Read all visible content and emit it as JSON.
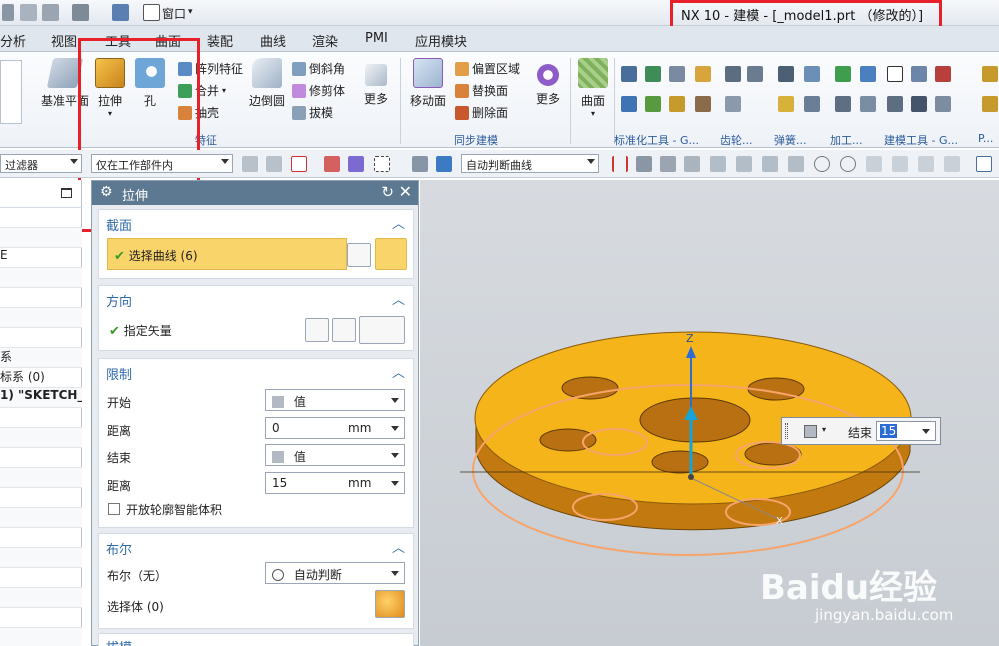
{
  "window": {
    "title": "NX 10 - 建模 - [_model1.prt （修改的）]",
    "window_menu": "窗口"
  },
  "menu": {
    "tabs": [
      "分析",
      "视图",
      "工具",
      "曲面",
      "装配",
      "曲线",
      "渲染",
      "PMI",
      "应用模块"
    ]
  },
  "ribbon": {
    "datum_plane": "基准平面",
    "extrude": "拉伸",
    "hole": "孔",
    "pattern_feature": "阵列特征",
    "combine": "合并",
    "shell": "抽壳",
    "edge_blend": "边倒圆",
    "chamfer": "倒斜角",
    "trim_body": "修剪体",
    "draft": "拔模",
    "more1": "更多",
    "move_face": "移动面",
    "offset_region": "偏置区域",
    "replace_face": "替换面",
    "delete_face": "删除面",
    "more2": "更多",
    "surface": "曲面",
    "group_feature": "特征",
    "group_sync": "同步建模",
    "group_std": "标准化工具 - G...",
    "group_gear": "齿轮...",
    "group_spring": "弹簧...",
    "group_machining": "加工...",
    "group_modeling_tools": "建模工具 - G...",
    "group_more": "P..."
  },
  "selection_bar": {
    "filter": "过滤器",
    "scope": "仅在工作部件内",
    "curve_rule": "自动判断曲线"
  },
  "navigator": {
    "rows": [
      "",
      "",
      "E",
      "",
      "",
      "",
      "",
      "系",
      "标系 (0)",
      "1) \"SKETCH_...",
      "",
      "",
      "",
      "",
      "",
      "",
      "",
      "",
      "",
      "",
      "",
      "",
      ""
    ]
  },
  "dialog": {
    "title": "拉伸",
    "section": {
      "title": "截面",
      "select_curve": "选择曲线 (6)"
    },
    "direction": {
      "title": "方向",
      "specify_vector": "指定矢量"
    },
    "limits": {
      "title": "限制",
      "start_label": "开始",
      "start_value": "值",
      "start_distance_label": "距离",
      "start_distance": "0",
      "start_unit": "mm",
      "end_label": "结束",
      "end_value": "值",
      "end_distance_label": "距离",
      "end_distance": "15",
      "end_unit": "mm",
      "open_profile": "开放轮廓智能体积"
    },
    "boolean": {
      "title": "布尔",
      "label": "布尔（无）",
      "value": "自动判断",
      "select_body": "选择体 (0)"
    },
    "draft": {
      "title": "拔模"
    }
  },
  "viewport": {
    "axis_z": "Z",
    "axis_x": "X",
    "popup_label": "结束",
    "popup_value": "15"
  },
  "watermark": {
    "brand": "Baidu经验",
    "url": "jingyan.baidu.com"
  },
  "colors": {
    "part_orange": "#f0a820",
    "accent_red": "#e8202a",
    "dialog_header": "#5d7891"
  }
}
